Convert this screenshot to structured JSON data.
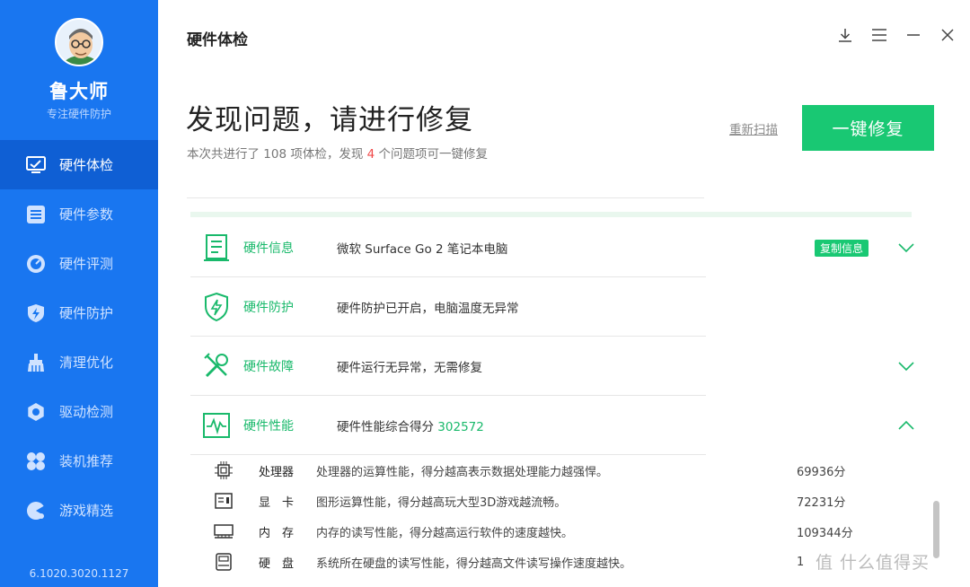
{
  "sidebar": {
    "brand": "鲁大师",
    "slogan": "专注硬件防护",
    "items": [
      {
        "label": "硬件体检",
        "icon": "monitor-check-icon",
        "active": true
      },
      {
        "label": "硬件参数",
        "icon": "list-icon",
        "active": false
      },
      {
        "label": "硬件评测",
        "icon": "speedometer-icon",
        "active": false
      },
      {
        "label": "硬件防护",
        "icon": "shield-bolt-icon",
        "active": false
      },
      {
        "label": "清理优化",
        "icon": "broom-icon",
        "active": false
      },
      {
        "label": "驱动检测",
        "icon": "gear-icon",
        "active": false
      },
      {
        "label": "装机推荐",
        "icon": "clover-icon",
        "active": false
      },
      {
        "label": "游戏精选",
        "icon": "game-icon",
        "active": false
      }
    ],
    "version": "6.1020.3020.1127"
  },
  "header": {
    "title": "硬件体检"
  },
  "summary": {
    "headline": "发现问题，请进行修复",
    "sub_prefix": "本次共进行了 108 项体检，发现 ",
    "issue_count": "4",
    "sub_suffix": " 个问题项可一键修复",
    "rescan_label": "重新扫描",
    "fix_label": "一键修复"
  },
  "sections": [
    {
      "title": "硬件信息",
      "desc": "微软 Surface Go 2 笔记本电脑",
      "badge": "复制信息",
      "icon": "document-icon"
    },
    {
      "title": "硬件防护",
      "desc": "硬件防护已开启，电脑温度无异常",
      "icon": "shield-icon"
    },
    {
      "title": "硬件故障",
      "desc": "硬件运行无异常，无需修复",
      "icon": "tools-icon"
    },
    {
      "title": "硬件性能",
      "desc": "硬件性能综合得分 ",
      "score": "302572",
      "icon": "pulse-icon"
    }
  ],
  "performance_rows": [
    {
      "name": "处理器",
      "desc": "处理器的运算性能，得分越高表示数据处理能力越强悍。",
      "score": "69936分",
      "icon": "cpu-icon"
    },
    {
      "name": "显　卡",
      "desc": "图形运算性能，得分越高玩大型3D游戏越流畅。",
      "score": "72231分",
      "icon": "gpu-icon"
    },
    {
      "name": "内　存",
      "desc": "内存的读写性能，得分越高运行软件的速度越快。",
      "score": "109344分",
      "icon": "memory-icon"
    },
    {
      "name": "硬　盘",
      "desc": "系统所在硬盘的读写性能，得分越高文件读写操作速度越快。",
      "score": "1",
      "icon": "disk-icon"
    }
  ],
  "watermark": "值 什么值得买",
  "colors": {
    "sidebar": "#1976f0",
    "sidebar_active": "#0f5fd4",
    "accent_green": "#19c873",
    "alert_red": "#f04a4a"
  }
}
